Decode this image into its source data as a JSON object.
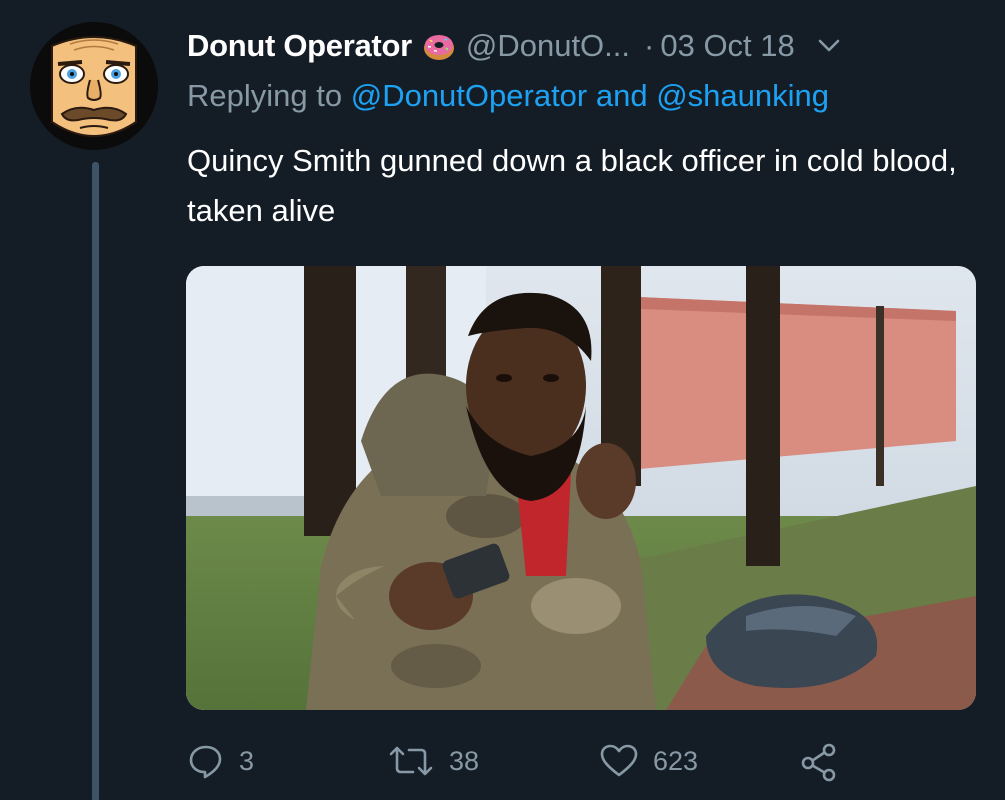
{
  "tweet": {
    "display_name": "Donut Operator",
    "name_emoji": "donut-emoji",
    "handle": "@DonutO...",
    "separator": "·",
    "date": "03 Oct 18",
    "reply_prefix": "Replying to ",
    "reply_mention_1": "@DonutOperator",
    "reply_and": " and ",
    "reply_mention_2": "@shaunking",
    "text": "Quincy Smith gunned down a black officer in cold blood, taken alive",
    "media_description_icon": "photo"
  },
  "actions": {
    "reply_count": "3",
    "retweet_count": "38",
    "like_count": "623"
  },
  "icons": {
    "reply": "reply-icon",
    "retweet": "retweet-icon",
    "like": "heart-icon",
    "share": "share-icon",
    "menu": "chevron-down-icon"
  },
  "colors": {
    "background": "#141d26",
    "secondary_text": "#8899a6",
    "link": "#1da1f2",
    "thread_line": "#3d5466"
  }
}
